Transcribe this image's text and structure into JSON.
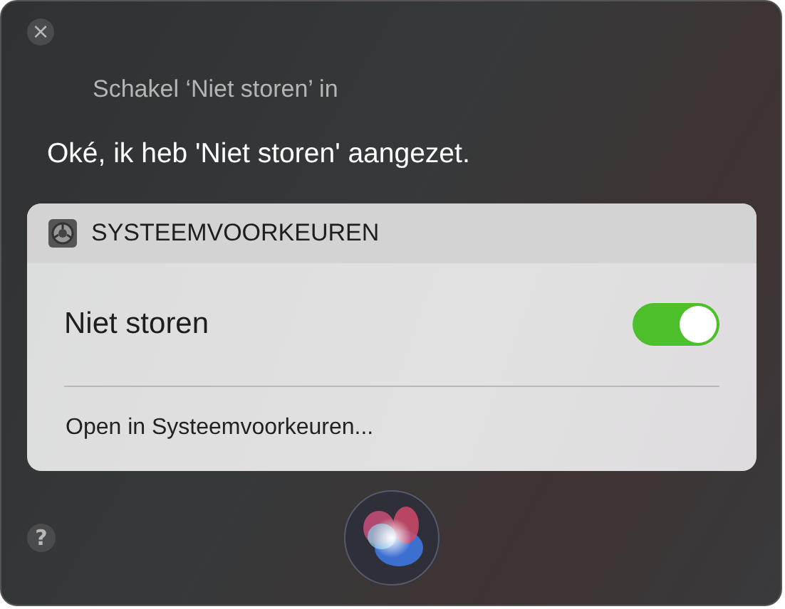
{
  "close_button": {
    "label": "×"
  },
  "query": "Schakel ‘Niet storen’ in",
  "response": "Oké, ik heb 'Niet storen' aangezet.",
  "card": {
    "app_name": "SYSTEEMVOORKEUREN",
    "setting": {
      "label": "Niet storen",
      "on": true
    },
    "link": "Open in Systeemvoorkeuren..."
  },
  "help_button": {
    "label": "?"
  }
}
